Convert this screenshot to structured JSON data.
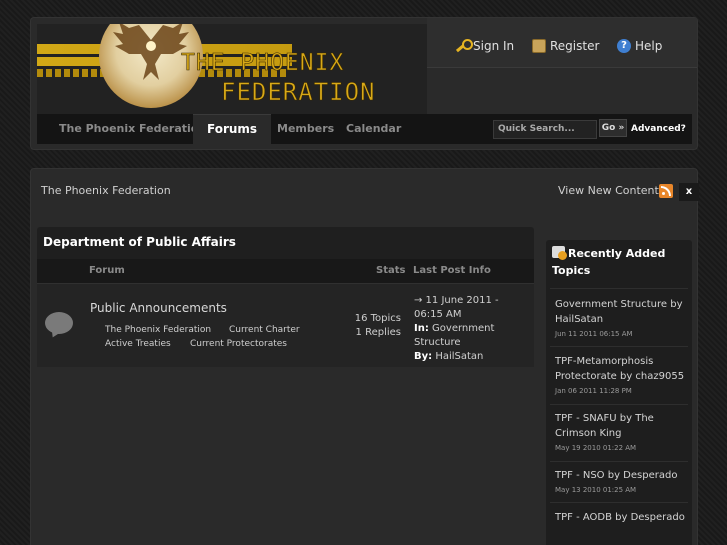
{
  "header": {
    "logo_line1": "THE PHOENIX",
    "logo_line2": "FEDERATION",
    "user_links": [
      {
        "label": "Sign In",
        "icon": "key-icon"
      },
      {
        "label": "Register",
        "icon": "register-icon"
      },
      {
        "label": "Help",
        "icon": "help-icon"
      }
    ],
    "nav_tabs": [
      "The Phoenix Federation",
      "Forums",
      "Members",
      "Calendar"
    ],
    "active_tab": "Forums",
    "search_placeholder": "Quick Search...",
    "go_label": "Go »",
    "advanced_label": "Advanced?"
  },
  "breadcrumb": "The Phoenix Federation",
  "view_new": "View New Content",
  "close_label": "x",
  "category": {
    "title": "Department of Public Affairs",
    "columns": {
      "forum": "Forum",
      "stats": "Stats",
      "last_post": "Last Post Info"
    },
    "forum": {
      "name": "Public Announcements",
      "subforums": [
        "The Phoenix Federation",
        "Current Charter",
        "Active Treaties",
        "Current Protectorates"
      ],
      "topics": "16 Topics",
      "replies": "1 Replies",
      "last_post_date": "→ 11 June 2011 - 06:15 AM",
      "last_post_in_label": "In:",
      "last_post_in": "Government Structure",
      "last_post_by_label": "By:",
      "last_post_by": "HailSatan"
    }
  },
  "sidebar": {
    "title": "Recently Added Topics",
    "topics": [
      {
        "title": "Government Structure by HailSatan",
        "date": "Jun 11 2011 06:15 AM"
      },
      {
        "title": "TPF-Metamorphosis Protectorate by chaz9055",
        "date": "Jan 06 2011 11:28 PM"
      },
      {
        "title": "TPF - SNAFU by The Crimson King",
        "date": "May 19 2010 01:22 AM"
      },
      {
        "title": "TPF - NSO by Desperado",
        "date": "May 13 2010 01:25 AM"
      },
      {
        "title": "TPF - AODB by Desperado",
        "date": ""
      }
    ]
  }
}
